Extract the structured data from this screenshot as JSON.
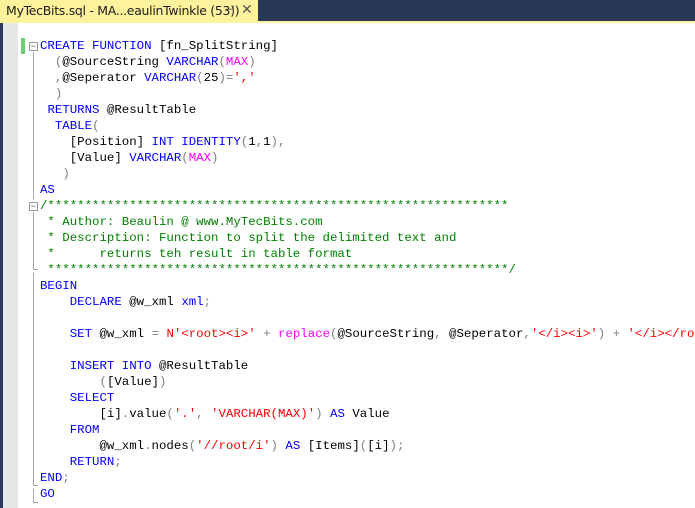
{
  "tab": {
    "title": "MyTecBits.sql - MA...eaulinTwinkle (53))",
    "pin_icon": "⊣",
    "close_icon": "✕"
  },
  "colors": {
    "tab_active": "#fff29d",
    "tabstrip": "#293955",
    "keyword": "#0000ff",
    "string": "#ff0000",
    "comment": "#008000",
    "function": "#ff00ff",
    "operator": "#808080",
    "change_bar": "#6ccf6f"
  },
  "code": {
    "lines": [
      [
        {
          "t": "CREATE FUNCTION ",
          "c": "k"
        },
        {
          "t": "[fn_SplitString]",
          "c": ""
        }
      ],
      [
        {
          "t": "  ",
          "c": ""
        },
        {
          "t": "(",
          "c": "g"
        },
        {
          "t": "@SourceString ",
          "c": ""
        },
        {
          "t": "VARCHAR",
          "c": "k"
        },
        {
          "t": "(",
          "c": "g"
        },
        {
          "t": "MAX",
          "c": "f"
        },
        {
          "t": ")",
          "c": "g"
        }
      ],
      [
        {
          "t": "  ",
          "c": ""
        },
        {
          "t": ",",
          "c": "g"
        },
        {
          "t": "@Seperator ",
          "c": ""
        },
        {
          "t": "VARCHAR",
          "c": "k"
        },
        {
          "t": "(",
          "c": "g"
        },
        {
          "t": "25",
          "c": ""
        },
        {
          "t": ")=",
          "c": "g"
        },
        {
          "t": "','",
          "c": "s"
        }
      ],
      [
        {
          "t": "  ",
          "c": ""
        },
        {
          "t": ")",
          "c": "g"
        }
      ],
      [
        {
          "t": " ",
          "c": ""
        },
        {
          "t": "RETURNS ",
          "c": "k"
        },
        {
          "t": "@ResultTable",
          "c": ""
        }
      ],
      [
        {
          "t": "  ",
          "c": ""
        },
        {
          "t": "TABLE",
          "c": "k"
        },
        {
          "t": "(",
          "c": "g"
        }
      ],
      [
        {
          "t": "    [Position] ",
          "c": ""
        },
        {
          "t": "INT IDENTITY",
          "c": "k"
        },
        {
          "t": "(",
          "c": "g"
        },
        {
          "t": "1",
          "c": ""
        },
        {
          "t": ",",
          "c": "g"
        },
        {
          "t": "1",
          "c": ""
        },
        {
          "t": "),",
          "c": "g"
        }
      ],
      [
        {
          "t": "    [Value] ",
          "c": ""
        },
        {
          "t": "VARCHAR",
          "c": "k"
        },
        {
          "t": "(",
          "c": "g"
        },
        {
          "t": "MAX",
          "c": "f"
        },
        {
          "t": ")",
          "c": "g"
        }
      ],
      [
        {
          "t": "   ",
          "c": ""
        },
        {
          "t": ")",
          "c": "g"
        }
      ],
      [
        {
          "t": "AS",
          "c": "k"
        }
      ],
      [
        {
          "t": "/**************************************************************",
          "c": "c"
        }
      ],
      [
        {
          "t": " * Author: Beaulin @ www.MyTecBits.com",
          "c": "c"
        }
      ],
      [
        {
          "t": " * Description: Function to split the delimited text and",
          "c": "c"
        }
      ],
      [
        {
          "t": " *      returns teh result in table format",
          "c": "c"
        }
      ],
      [
        {
          "t": " **************************************************************/",
          "c": "c"
        }
      ],
      [
        {
          "t": "BEGIN",
          "c": "k"
        }
      ],
      [
        {
          "t": "    ",
          "c": ""
        },
        {
          "t": "DECLARE ",
          "c": "k"
        },
        {
          "t": "@w_xml ",
          "c": ""
        },
        {
          "t": "xml",
          "c": "k"
        },
        {
          "t": ";",
          "c": "g"
        }
      ],
      [],
      [
        {
          "t": "    ",
          "c": ""
        },
        {
          "t": "SET ",
          "c": "k"
        },
        {
          "t": "@w_xml ",
          "c": ""
        },
        {
          "t": "= ",
          "c": "g"
        },
        {
          "t": "N'<root><i>'",
          "c": "s"
        },
        {
          "t": " + ",
          "c": "g"
        },
        {
          "t": "replace",
          "c": "f"
        },
        {
          "t": "(",
          "c": "g"
        },
        {
          "t": "@SourceString",
          "c": ""
        },
        {
          "t": ", ",
          "c": "g"
        },
        {
          "t": "@Seperator",
          "c": ""
        },
        {
          "t": ",",
          "c": "g"
        },
        {
          "t": "'</i><i>'",
          "c": "s"
        },
        {
          "t": ") + ",
          "c": "g"
        },
        {
          "t": "'</i></root>'",
          "c": "s"
        },
        {
          "t": ";",
          "c": "g"
        }
      ],
      [],
      [
        {
          "t": "    ",
          "c": ""
        },
        {
          "t": "INSERT INTO ",
          "c": "k"
        },
        {
          "t": "@ResultTable",
          "c": ""
        }
      ],
      [
        {
          "t": "        ",
          "c": ""
        },
        {
          "t": "(",
          "c": "g"
        },
        {
          "t": "[Value]",
          "c": ""
        },
        {
          "t": ")",
          "c": "g"
        }
      ],
      [
        {
          "t": "    ",
          "c": ""
        },
        {
          "t": "SELECT",
          "c": "k"
        }
      ],
      [
        {
          "t": "        [i]",
          "c": ""
        },
        {
          "t": ".",
          "c": "g"
        },
        {
          "t": "value",
          "c": ""
        },
        {
          "t": "(",
          "c": "g"
        },
        {
          "t": "'.'",
          "c": "s"
        },
        {
          "t": ", ",
          "c": "g"
        },
        {
          "t": "'VARCHAR(MAX)'",
          "c": "s"
        },
        {
          "t": ") ",
          "c": "g"
        },
        {
          "t": "AS ",
          "c": "k"
        },
        {
          "t": "Value",
          "c": ""
        }
      ],
      [
        {
          "t": "    ",
          "c": ""
        },
        {
          "t": "FROM",
          "c": "k"
        }
      ],
      [
        {
          "t": "        @w_xml",
          "c": ""
        },
        {
          "t": ".",
          "c": "g"
        },
        {
          "t": "nodes",
          "c": ""
        },
        {
          "t": "(",
          "c": "g"
        },
        {
          "t": "'//root/i'",
          "c": "s"
        },
        {
          "t": ") ",
          "c": "g"
        },
        {
          "t": "AS ",
          "c": "k"
        },
        {
          "t": "[Items]",
          "c": ""
        },
        {
          "t": "(",
          "c": "g"
        },
        {
          "t": "[i]",
          "c": ""
        },
        {
          "t": ");",
          "c": "g"
        }
      ],
      [
        {
          "t": "    ",
          "c": ""
        },
        {
          "t": "RETURN",
          "c": "k"
        },
        {
          "t": ";",
          "c": "g"
        }
      ],
      [
        {
          "t": "END",
          "c": "k"
        },
        {
          "t": ";",
          "c": "g"
        }
      ],
      [
        {
          "t": "GO",
          "c": "k"
        }
      ]
    ]
  }
}
